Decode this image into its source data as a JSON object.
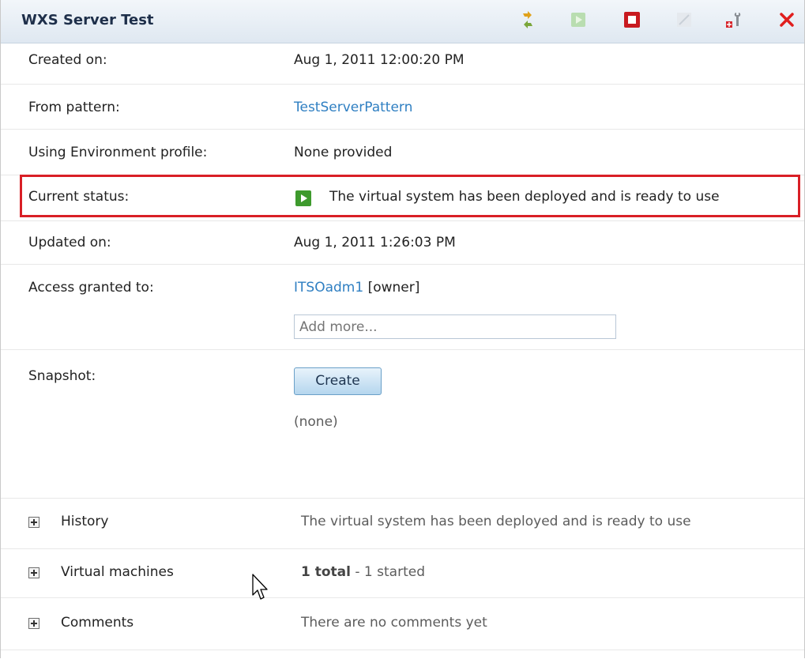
{
  "window": {
    "title": "WXS Server Test"
  },
  "toolbar": {
    "icons": [
      "refresh-icon",
      "start-icon",
      "stop-icon",
      "edit-icon",
      "configure-icon",
      "delete-icon"
    ],
    "colors": {
      "stop": "#d0141c",
      "delete": "#e01e1e",
      "start_disabled": "#a9d49a"
    }
  },
  "details": {
    "created_on": {
      "label": "Created on:",
      "value": "Aug 1, 2011 12:00:20 PM"
    },
    "from_pattern": {
      "label": "From pattern:",
      "value": "TestServerPattern"
    },
    "environment_profile": {
      "label": "Using Environment profile:",
      "value": "None provided"
    },
    "current_status": {
      "label": "Current status:",
      "value": "The virtual system has been deployed and is ready to use",
      "highlight_color": "#d91f26"
    },
    "updated_on": {
      "label": "Updated on:",
      "value": "Aug 1, 2011 1:26:03 PM"
    },
    "access": {
      "label": "Access granted to:",
      "user": "ITSOadm1",
      "role": "[owner]",
      "placeholder": "Add more..."
    },
    "snapshot": {
      "label": "Snapshot:",
      "button_label": "Create",
      "value": "(none)"
    }
  },
  "sections": {
    "history": {
      "label": "History",
      "value": "The virtual system has been deployed and is ready to use"
    },
    "virtual_machines": {
      "label": "Virtual machines",
      "total": "1 total",
      "rest": " - 1 started"
    },
    "comments": {
      "label": "Comments",
      "value": "There are no comments yet"
    }
  }
}
